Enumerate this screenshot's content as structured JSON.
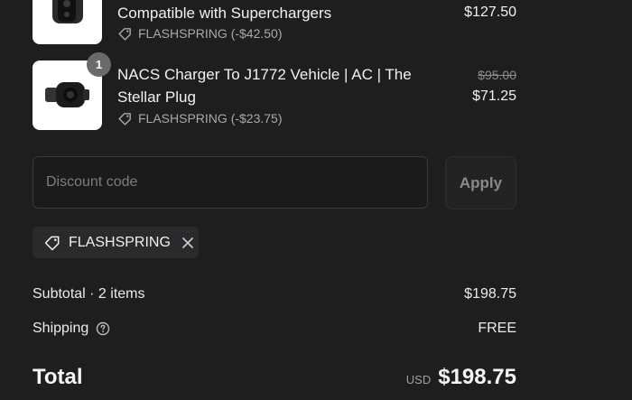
{
  "items": [
    {
      "title": "Compatible with Superchargers",
      "discount": "FLASHSPRING (-$42.50)",
      "price": "$127.50",
      "image_icon": "adapter-product-image"
    },
    {
      "title": "NACS Charger To J1772 Vehicle | AC | The Stellar Plug",
      "discount": "FLASHSPRING (-$23.75)",
      "original_price": "$95.00",
      "price": "$71.25",
      "quantity": "1",
      "image_icon": "plug-product-image"
    }
  ],
  "discount_form": {
    "placeholder": "Discount code",
    "apply_label": "Apply"
  },
  "applied_code": {
    "label": "FLASHSPRING",
    "icon": "tag-icon",
    "remove_icon": "close-icon"
  },
  "summary": {
    "subtotal_label": "Subtotal · 2 items",
    "subtotal_value": "$198.75",
    "shipping_label": "Shipping",
    "shipping_value": "FREE",
    "total_label": "Total",
    "currency": "USD",
    "total_value": "$198.75"
  },
  "colors": {
    "background": "#1e1e1f",
    "text": "#ececec",
    "muted": "#a9a9ab",
    "chip_bg": "#2a2a2c"
  }
}
